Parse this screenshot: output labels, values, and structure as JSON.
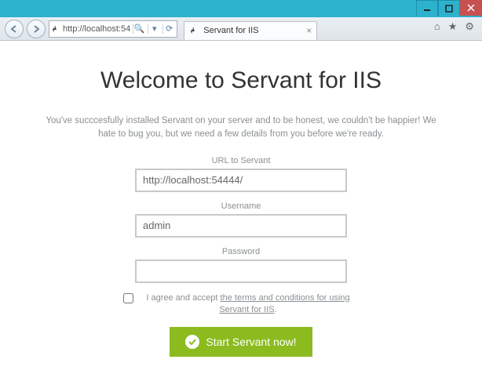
{
  "window": {
    "url_display": "http://localhost:54",
    "tab_title": "Servant for IIS"
  },
  "page": {
    "heading": "Welcome to Servant for IIS",
    "intro": "You've succcesfully installed Servant on your server and to be honest, we couldn't be happier! We hate to bug you, but we need a few details from you before we're ready.",
    "url_label": "URL to Servant",
    "url_value": "http://localhost:54444/",
    "username_label": "Username",
    "username_value": "admin",
    "password_label": "Password",
    "password_value": "",
    "agree_prefix": "I agree and accept ",
    "agree_link": "the terms and conditions for using Servant for IIS",
    "agree_suffix": ".",
    "start_button": "Start Servant now!"
  }
}
